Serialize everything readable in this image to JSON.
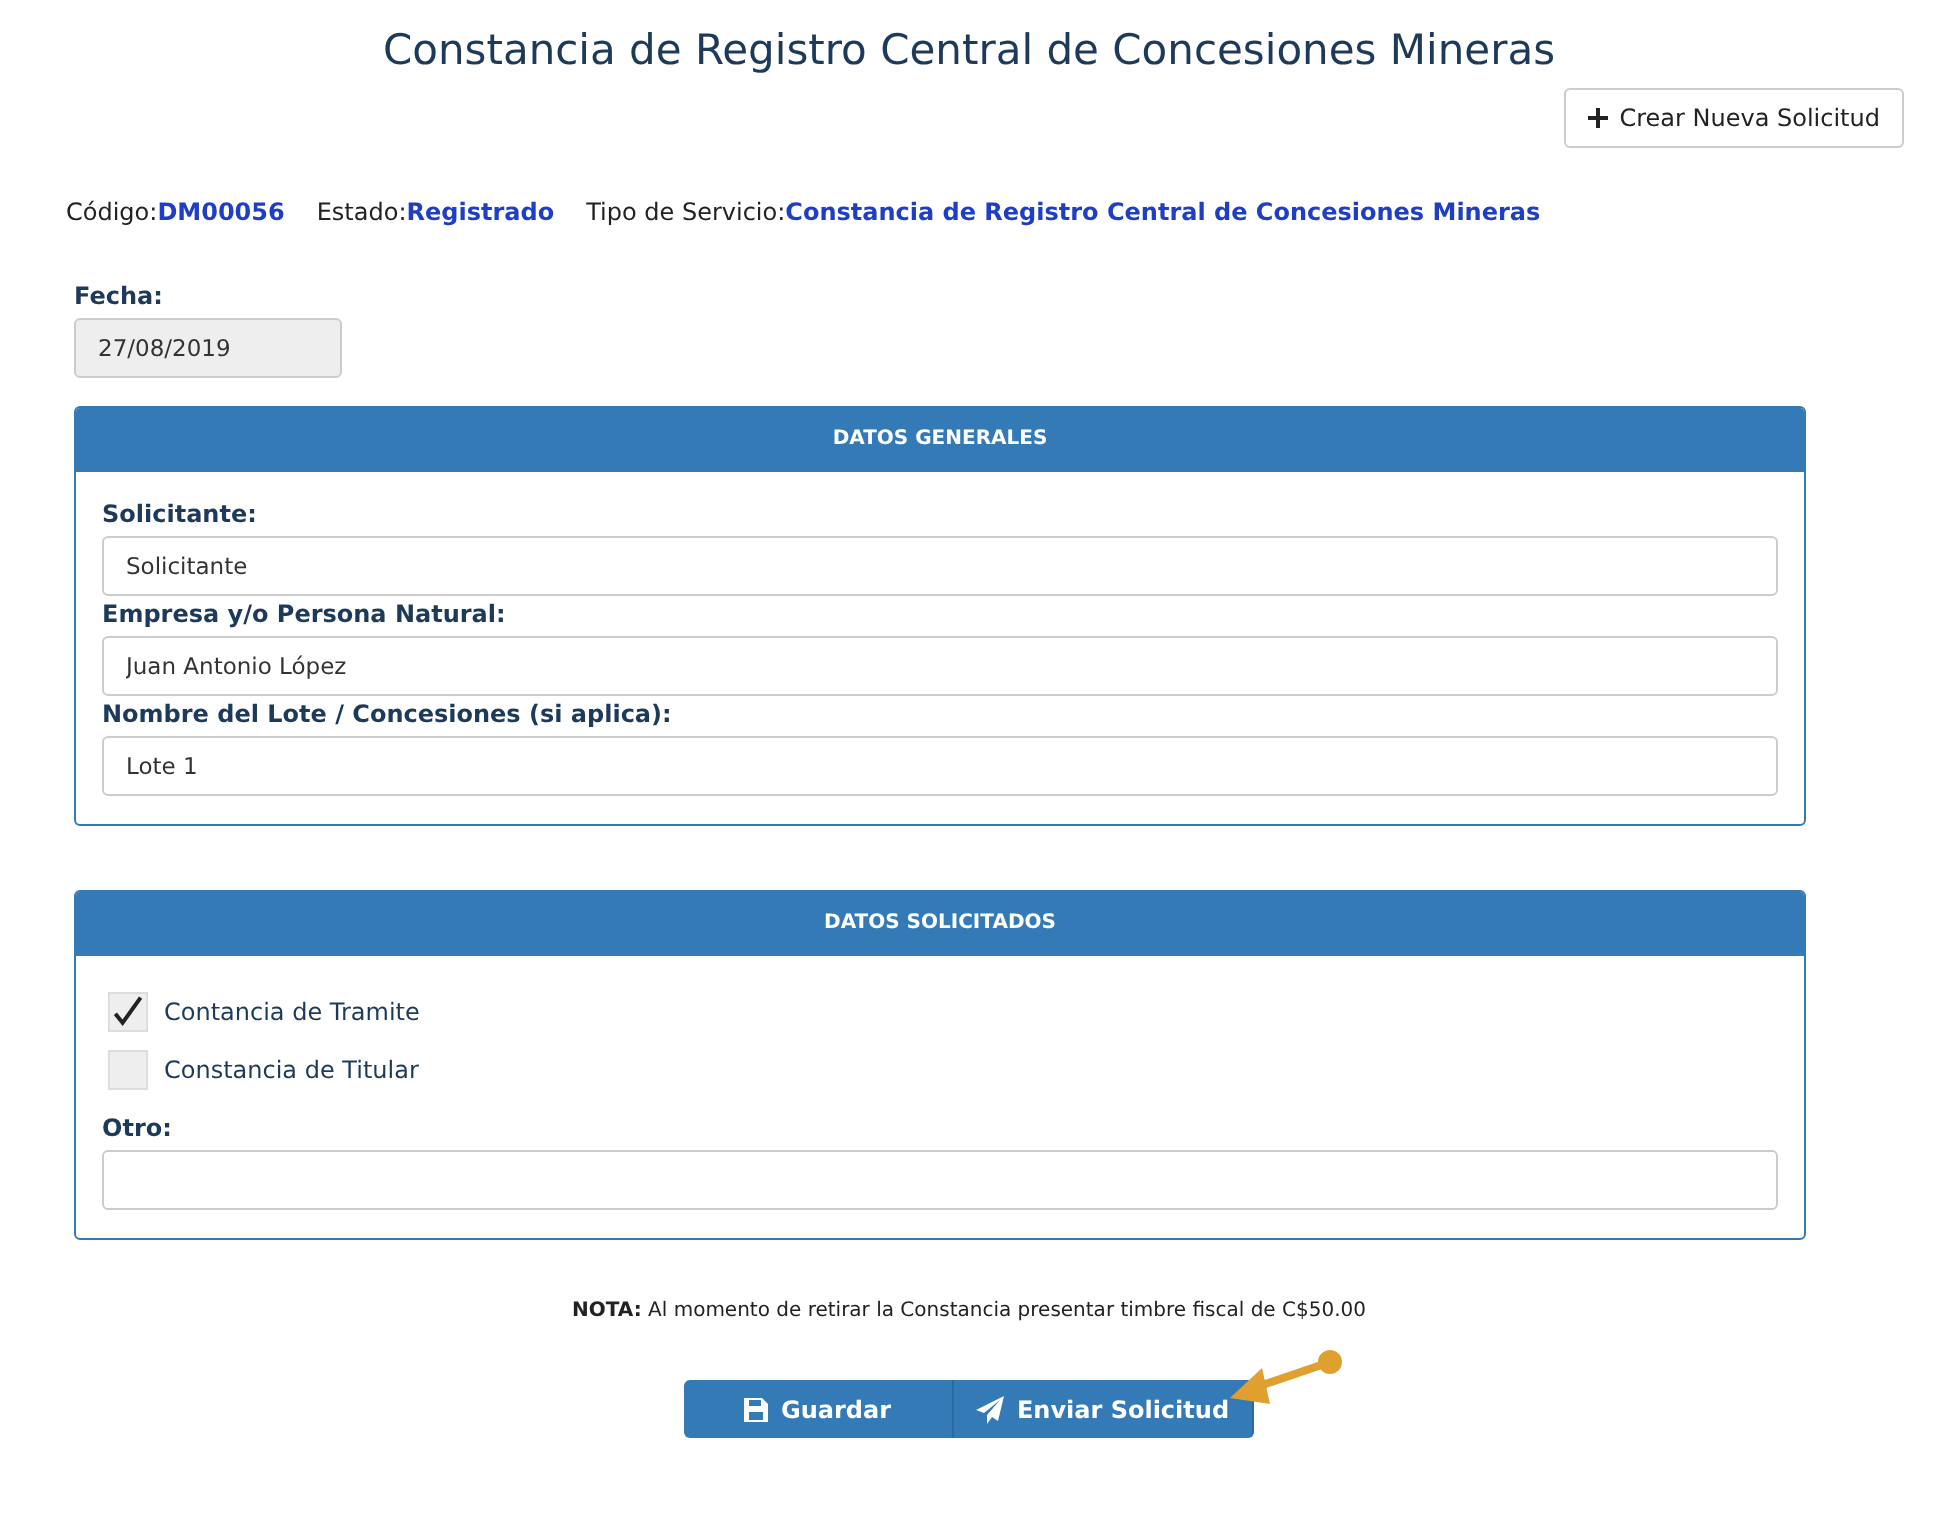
{
  "title": "Constancia de Registro Central de Concesiones Mineras",
  "new_button": {
    "label": "Crear Nueva Solicitud"
  },
  "info": [
    {
      "label": "Código:",
      "value": "DM00056"
    },
    {
      "label": "Estado:",
      "value": "Registrado"
    },
    {
      "label": "Tipo de Servicio:",
      "value": "Constancia de Registro Central de Concesiones Mineras"
    }
  ],
  "fecha": {
    "label": "Fecha:",
    "value": "27/08/2019",
    "disabled": true
  },
  "sections": [
    {
      "title": "DATOS GENERALES",
      "fields": [
        {
          "label": "Solicitante:",
          "value": "Solicitante"
        },
        {
          "label": "Empresa y/o Persona Natural:",
          "value": "Juan Antonio López"
        },
        {
          "label": "Nombre del Lote / Concesiones (si aplica):",
          "value": "Lote 1"
        }
      ]
    },
    {
      "title": "DATOS SOLICITADOS",
      "options": [
        {
          "label": "Contancia de Tramite",
          "checked": true
        },
        {
          "label": "Constancia de Titular",
          "checked": false
        }
      ],
      "fields": [
        {
          "label": "Otro:"
        }
      ]
    }
  ],
  "note": "**NOTA:** Al momento de retirar la Constancia presentar timbre fiscal de C$50.00",
  "buttons": [
    {
      "label": "Guardar"
    },
    {
      "label": "Enviar Solicitud"
    }
  ]
}
